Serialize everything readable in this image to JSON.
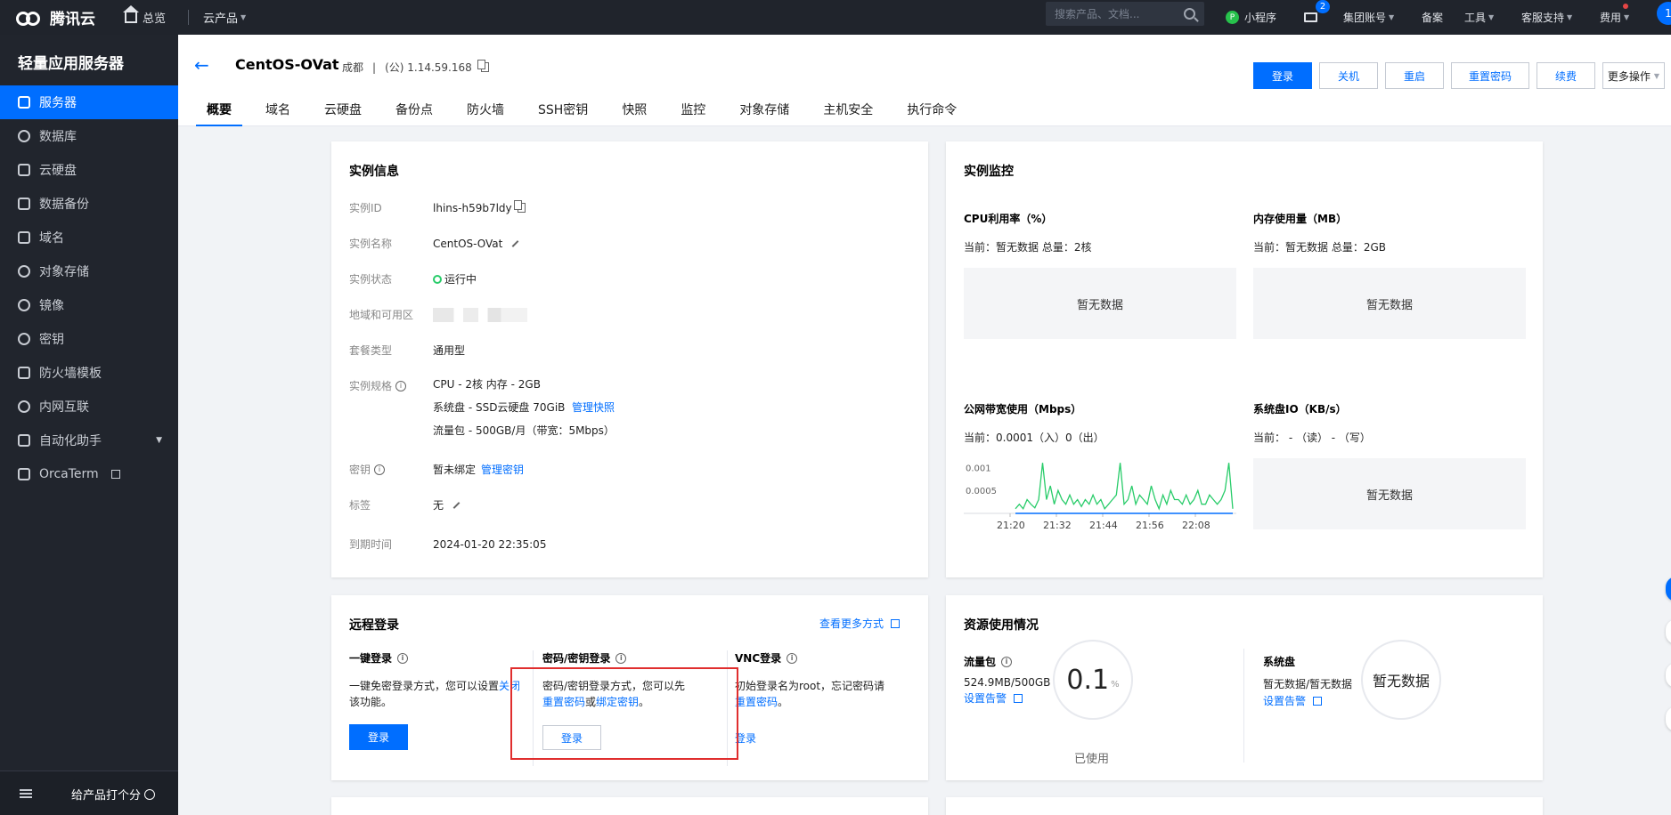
{
  "topbar": {
    "brand": "腾讯云",
    "home": "总览",
    "products": "云产品",
    "search_placeholder": "搜索产品、文档...",
    "mini_program": "小程序",
    "mini_icon_glyph": "P",
    "mail_badge": "2",
    "items": [
      "集团账号",
      "备案",
      "工具",
      "客服支持",
      "费用"
    ],
    "avatar": "1"
  },
  "sidebar": {
    "title": "轻量应用服务器",
    "items": [
      {
        "label": "服务器",
        "icon": "server-icon"
      },
      {
        "label": "数据库",
        "icon": "database-icon"
      },
      {
        "label": "云硬盘",
        "icon": "disk-icon"
      },
      {
        "label": "数据备份",
        "icon": "backup-icon"
      },
      {
        "label": "域名",
        "icon": "domain-icon"
      },
      {
        "label": "对象存储",
        "icon": "storage-icon"
      },
      {
        "label": "镜像",
        "icon": "image-icon"
      },
      {
        "label": "密钥",
        "icon": "key-icon"
      },
      {
        "label": "防火墙模板",
        "icon": "firewall-icon"
      },
      {
        "label": "内网互联",
        "icon": "network-icon"
      },
      {
        "label": "自动化助手",
        "icon": "automation-icon"
      },
      {
        "label": "OrcaTerm",
        "icon": "terminal-icon"
      }
    ],
    "feedback": "给产品打个分"
  },
  "header": {
    "title": "CentOS-OVat",
    "region": "成都",
    "divider": "|",
    "ip": "(公) 1.14.59.168",
    "actions": [
      "登录",
      "关机",
      "重启",
      "重置密码",
      "续费",
      "更多操作"
    ],
    "tabs": [
      "概要",
      "域名",
      "云硬盘",
      "备份点",
      "防火墙",
      "SSH密钥",
      "快照",
      "监控",
      "对象存储",
      "主机安全",
      "执行命令"
    ]
  },
  "instance_info": {
    "title": "实例信息",
    "id_label": "实例ID",
    "id": "lhins-h59b7ldy",
    "name_label": "实例名称",
    "name": "CentOS-OVat",
    "status_label": "实例状态",
    "status": "运行中",
    "zone_label": "地域和可用区",
    "package_label": "套餐类型",
    "package": "通用型",
    "spec_label": "实例规格",
    "spec_cpu": "CPU - 2核 内存 - 2GB",
    "spec_disk": "系统盘 - SSD云硬盘 70GiB",
    "spec_disk_link": "管理快照",
    "spec_traffic": "流量包 - 500GB/月（带宽：5Mbps）",
    "key_label": "密钥",
    "key": "暂未绑定",
    "key_link": "管理密钥",
    "tag_label": "标签",
    "tag": "无",
    "expire_label": "到期时间",
    "expire": "2024-01-20 22:35:05"
  },
  "monitor": {
    "title": "实例监控",
    "cpu_title": "CPU利用率（%）",
    "cpu_sub": "当前：暂无数据 总量：2核",
    "cpu_empty": "暂无数据",
    "mem_title": "内存使用量（MB）",
    "mem_sub": "当前：暂无数据 总量：2GB",
    "mem_empty": "暂无数据",
    "bw_title": "公网带宽使用（Mbps）",
    "bw_sub": "当前：0.0001（入）0（出）",
    "io_title": "系统盘IO（KB/s）",
    "io_sub": "当前： - （读） - （写）",
    "io_empty": "暂无数据"
  },
  "chart_data": {
    "type": "line",
    "x_ticks": [
      "21:20",
      "21:32",
      "21:44",
      "21:56",
      "22:08"
    ],
    "y_ticks": [
      "0.001",
      "0.0005"
    ],
    "ylim": [
      0,
      0.0012
    ],
    "series": [
      {
        "values": [
          0.0001,
          0.0002,
          0.0001,
          0.0003,
          0.0002,
          0.00012,
          0.0003,
          0.0011,
          0.0003,
          0.0006,
          0.0002,
          0.0005,
          0.0003,
          0.0002,
          0.0004,
          0.0002,
          0.0003,
          0.00015,
          0.0003,
          0.0002,
          0.0004,
          0.0002,
          0.0003,
          0.0001,
          0.0002,
          0.0003,
          0.0004,
          0.0011,
          0.0002,
          0.0003,
          0.0006,
          0.0002,
          0.0004,
          0.0003,
          0.0002,
          0.0006,
          0.0003,
          0.0001,
          0.0004,
          0.0002,
          0.0005,
          0.0003,
          0.0003,
          0.0002,
          0.0004,
          0.0002,
          0.0003,
          0.0005,
          0.0002,
          0.0002,
          0.0004,
          0.0003,
          0.0002,
          0.0003,
          0.0005,
          0.0011,
          0.0001
        ],
        "color": "#29cc6a"
      },
      {
        "values": [
          0,
          0,
          0,
          0,
          0,
          0,
          0,
          0,
          0,
          0,
          0,
          0,
          0,
          0,
          0,
          0,
          0,
          0,
          0,
          0,
          0,
          0,
          0,
          0,
          0,
          0,
          0,
          0,
          0,
          0,
          0,
          0,
          0,
          0,
          0,
          0,
          0,
          0,
          0,
          0,
          0,
          0,
          0,
          0,
          0,
          0,
          0,
          0,
          0,
          0,
          0,
          0,
          0,
          0,
          0,
          0,
          0
        ],
        "color": "#006eff"
      }
    ]
  },
  "remote_login": {
    "title": "远程登录",
    "more_link": "查看更多方式",
    "one_click_title": "一键登录",
    "one_click_desc_1": "一键免密登录方式，您可以设置",
    "one_click_link": "关闭",
    "one_click_desc_2": "该功能。",
    "one_click_btn": "登录",
    "pwd_title": "密码/密钥登录",
    "pwd_desc_1": "密码/密钥登录方式，您可以先",
    "pwd_link_1": "重置密码",
    "pwd_or": "或",
    "pwd_link_2": "绑定密钥",
    "pwd_end": "。",
    "pwd_btn": "登录",
    "vnc_title": "VNC登录",
    "vnc_desc_1": "初始登录名为root，忘记密码请",
    "vnc_link": "重置密码",
    "vnc_end": "。",
    "vnc_btn": "登录"
  },
  "resources": {
    "title": "资源使用情况",
    "traffic_title": "流量包",
    "traffic_value": "524.9MB/500GB",
    "traffic_alarm": "设置告警",
    "traffic_gauge": "0.1",
    "traffic_unit": "%",
    "traffic_used": "已使用",
    "disk_title": "系统盘",
    "disk_value": "暂无数据/暂无数据",
    "disk_alarm": "设置告警",
    "disk_gauge": "暂无数据"
  },
  "colors": {
    "primary": "#006eff",
    "topbar": "#20242c",
    "sidebar": "#21252d",
    "highlight": "#e02e2e",
    "running": "#29cc6a"
  }
}
